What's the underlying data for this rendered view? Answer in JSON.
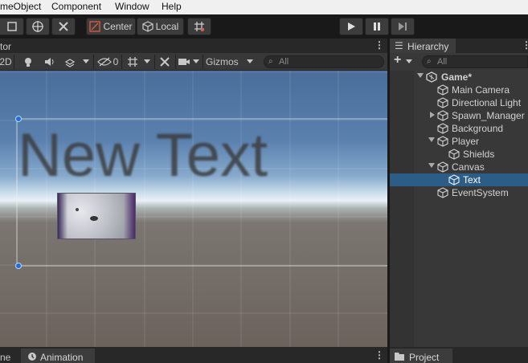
{
  "menu": {
    "gameobject": "meObject",
    "component": "Component",
    "window": "Window",
    "help": "Help"
  },
  "toolbar": {
    "pivot_label": "Center",
    "space_label": "Local"
  },
  "scene": {
    "tab_label": "tor",
    "mode_2d": "2D",
    "hidden_count": "0",
    "gizmos_label": "Gizmos",
    "search_placeholder": "All",
    "canvas_text": "New Text"
  },
  "hierarchy": {
    "tab_label": "Hierarchy",
    "search_placeholder": "All",
    "items": [
      {
        "label": "Game*",
        "depth": 0,
        "expanded": true,
        "selected": false
      },
      {
        "label": "Main Camera",
        "depth": 1,
        "selected": false
      },
      {
        "label": "Directional Light",
        "depth": 1,
        "selected": false
      },
      {
        "label": "Spawn_Manager",
        "depth": 1,
        "expanded": false,
        "selected": false
      },
      {
        "label": "Background",
        "depth": 1,
        "selected": false
      },
      {
        "label": "Player",
        "depth": 1,
        "expanded": true,
        "selected": false
      },
      {
        "label": "Shields",
        "depth": 2,
        "selected": false
      },
      {
        "label": "Canvas",
        "depth": 1,
        "expanded": true,
        "selected": false
      },
      {
        "label": "Text",
        "depth": 2,
        "selected": true
      },
      {
        "label": "EventSystem",
        "depth": 1,
        "selected": false
      }
    ]
  },
  "bottom": {
    "left_tab_fragment": "ne",
    "animation_tab": "Animation",
    "project_tab": "Project"
  },
  "colors": {
    "selection": "#2c5d87",
    "panel_bg": "#383838",
    "toolbar_bg": "#191919"
  }
}
